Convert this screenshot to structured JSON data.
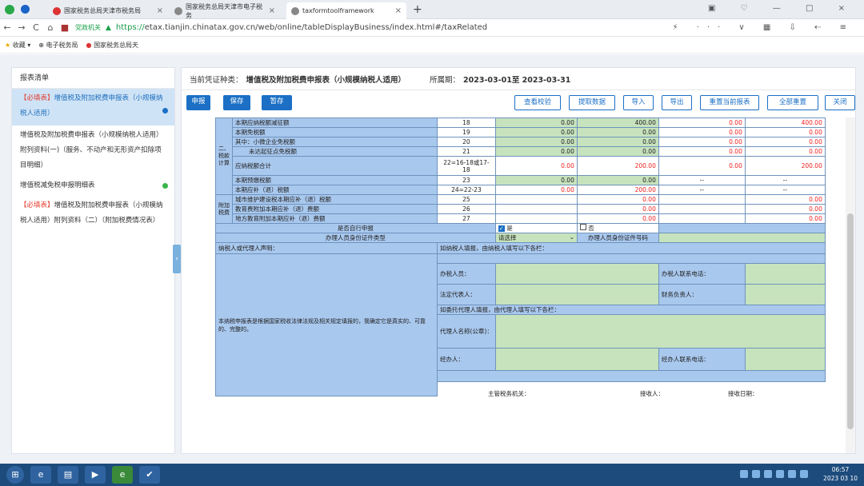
{
  "tabs": [
    "国家税务总局天津市税务局",
    "国家税务总局天津市电子税务",
    "taxformtoolframework"
  ],
  "address": {
    "badge": "党政机关",
    "scheme": "https://",
    "path": "etax.tianjin.chinatax.gov.cn/web/online/tableDisplayBusiness/index.html#/taxRelated"
  },
  "bookmarks": [
    "收藏",
    "电子税务局",
    "国家税务总局天"
  ],
  "sidebar": {
    "title": "报表清单",
    "items": [
      {
        "tag": "【必填表】",
        "label": "增值税及附加税费申报表（小规模纳税人适用）"
      },
      {
        "label": "增值税及附加税费申报表（小规模纳税人适用）附列资料(一)（服务、不动产和无形资产扣除项目明细）"
      },
      {
        "label": "增值税减免税申报明细表"
      },
      {
        "tag": "【必填表】",
        "label": "增值税及附加税费申报表（小规模纳税人适用）附列资料（二）（附加税费情况表）"
      }
    ]
  },
  "header": {
    "voucher_label": "当前凭证种类：",
    "voucher_value": "增值税及附加税费申报表（小规模纳税人适用）",
    "period_label": "所属期：",
    "period_value": "2023-03-01至 2023-03-31"
  },
  "toolbar": {
    "declare": "申报",
    "save": "保存",
    "temp_save": "暂存",
    "check": "查看校验",
    "fetch": "提取数据",
    "import": "导入",
    "export": "导出",
    "reset_current": "重置当前报表",
    "reset_all": "全部重置",
    "close": "关闭"
  },
  "section_labels": {
    "calc": "二、税款计算",
    "surtax": "附加税费"
  },
  "rows": [
    {
      "label": "本期应纳税额减征额",
      "line": "18",
      "v": [
        "0.00",
        "400.00",
        "0.00",
        "400.00"
      ]
    },
    {
      "label": "本期免税额",
      "line": "19",
      "v": [
        "0.00",
        "0.00",
        "0.00",
        "0.00"
      ]
    },
    {
      "label": "其中：小微企业免税额",
      "line": "20",
      "v": [
        "0.00",
        "0.00",
        "0.00",
        "0.00"
      ]
    },
    {
      "label": "未达起征点免税额",
      "line": "21",
      "v": [
        "0.00",
        "0.00",
        "0.00",
        "0.00"
      ]
    },
    {
      "label": "应纳税额合计",
      "line": "22=16-18或17-18",
      "v": [
        "0.00",
        "200.00",
        "0.00",
        "200.00"
      ]
    },
    {
      "label": "本期预缴税额",
      "line": "23",
      "v": [
        "0.00",
        "0.00",
        "--",
        "--"
      ]
    },
    {
      "label": "本期应补（退）税额",
      "line": "24=22-23",
      "v": [
        "0.00",
        "200.00",
        "--",
        "--"
      ]
    },
    {
      "label": "城市维护建设税本期应补（退）税额",
      "line": "25",
      "v": [
        "0.00",
        "0.00"
      ]
    },
    {
      "label": "教育费附加本期应补（退）费额",
      "line": "26",
      "v": [
        "0.00",
        "0.00"
      ]
    },
    {
      "label": "地方教育附加本期应补（退）费额",
      "line": "27",
      "v": [
        "0.00",
        "0.00"
      ]
    }
  ],
  "self_declare": {
    "label": "是否自行申报",
    "yes": "是",
    "no": "否"
  },
  "agent_id": {
    "label": "办理人员身份证件类型",
    "value": "请选择",
    "no_label": "办理人员身份证件号码"
  },
  "declaration": {
    "header": "纳税人或代理人声明：",
    "text": "本纳税申报表是根据国家税收法律法规及相关规定填报的，我确定它是真实的、可靠的、完整的。",
    "self_note": "如纳税人填报，由纳税人填写以下各栏：",
    "handler": "办税人员：",
    "handler_phone": "办税人联系电话：",
    "legal_rep": "法定代表人：",
    "finance": "财务负责人：",
    "agent_note": "如委托代理人填报，由代理人填写以下各栏：",
    "agent_name": "代理人名称(公章)：",
    "operator": "经办人：",
    "operator_phone": "经办人联系电话："
  },
  "footer": {
    "authority": "主管税务机关：",
    "receiver": "接收人：",
    "date": "接收日期："
  },
  "taskbar": {
    "time": "06:57",
    "date": "2023 03 10"
  }
}
